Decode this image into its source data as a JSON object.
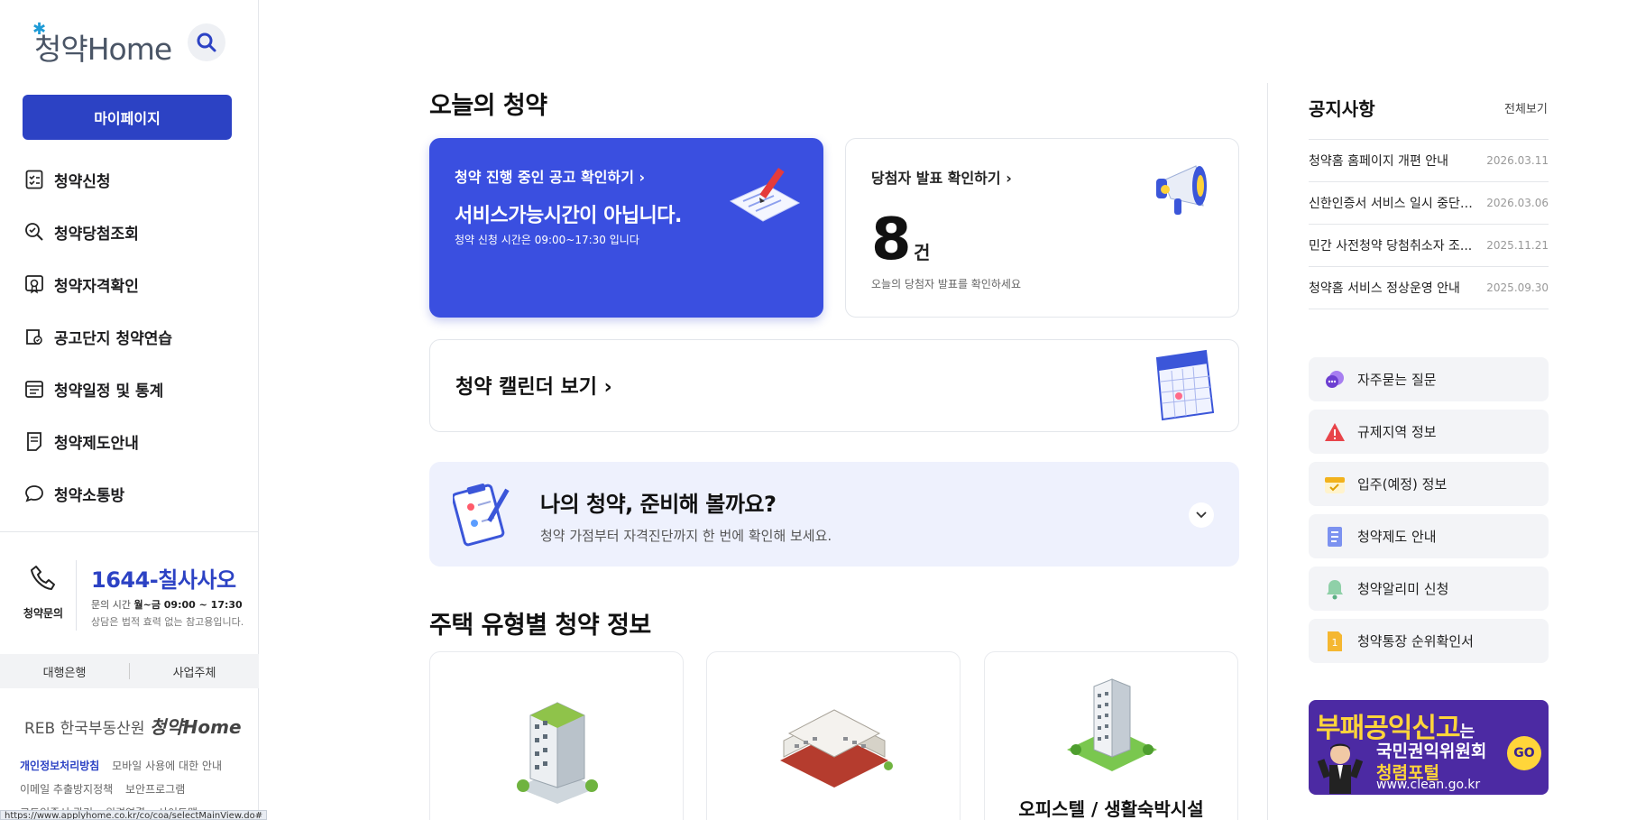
{
  "sidebar": {
    "logo_text": "청약Home",
    "mypage": "마이페이지",
    "items": [
      {
        "label": "청약신청",
        "icon": "checklist-icon"
      },
      {
        "label": "청약당첨조회",
        "icon": "search-check-icon"
      },
      {
        "label": "청약자격확인",
        "icon": "certificate-icon"
      },
      {
        "label": "공고단지 청약연습",
        "icon": "practice-icon"
      },
      {
        "label": "청약일정 및 통계",
        "icon": "calendar-stats-icon"
      },
      {
        "label": "청약제도안내",
        "icon": "document-icon"
      },
      {
        "label": "청약소통방",
        "icon": "chat-bubble-icon"
      }
    ],
    "contact": {
      "label": "청약문의",
      "phone": "1644-칠사사오",
      "hours_prefix": "문의 시간",
      "hours_value": "월~금 09:00 ~ 17:30",
      "note": "상담은 법적 효력 없는 참고용입니다."
    },
    "bank_tabs": [
      "대행은행",
      "사업주체"
    ],
    "footer_logo_prefix": "REB 한국부동산원",
    "footer_logo_brand": "청약Home",
    "footer_links": [
      "개인정보처리방침",
      "모바일 사용에 대한 안내",
      "이메일 추출방지정책",
      "보안프로그램",
      "고도인증서 관리",
      "원격연결",
      "사이트맵"
    ],
    "status_url": "https://www.applyhome.co.kr/co/coa/selectMainView.do#"
  },
  "main": {
    "title": "오늘의 청약",
    "card_apply": {
      "link": "청약 진행 중인 공고 확인하기",
      "message": "서비스가능시간이 아닙니다.",
      "sub": "청약 신청 시간은 09:00~17:30 입니다"
    },
    "card_winner": {
      "link": "당첨자 발표 확인하기",
      "count": "8",
      "unit": "건",
      "sub": "오늘의 당첨자 발표를 확인하세요"
    },
    "calendar_link": "청약 캘린더 보기",
    "prep": {
      "title": "나의 청약, 준비해 볼까요?",
      "sub": "청약 가점부터 자격진단까지 한 번에 확인해 보세요."
    },
    "house_section_title": "주택 유형별 청약 정보",
    "house_cards": [
      {
        "caption": ""
      },
      {
        "caption": ""
      },
      {
        "caption": "오피스텔 / 생활숙박시설"
      }
    ]
  },
  "notice": {
    "title": "공지사항",
    "view_all": "전체보기",
    "items": [
      {
        "title": "청약홈 홈페이지 개편 안내",
        "date": "2026.03.11"
      },
      {
        "title": "신한인증서 서비스 일시 중단 ...",
        "date": "2026.03.06"
      },
      {
        "title": "민간 사전청약 당첨취소자 조...",
        "date": "2025.11.21"
      },
      {
        "title": "청약홈 서비스 정상운영 안내",
        "date": "2025.09.30"
      }
    ]
  },
  "quick_links": [
    {
      "label": "자주묻는 질문",
      "icon": "faq-bubble-icon",
      "color": "#7b4fd8"
    },
    {
      "label": "규제지역 정보",
      "icon": "warning-icon",
      "color": "#e8444a"
    },
    {
      "label": "입주(예정) 정보",
      "icon": "calendar-check-icon",
      "color": "#f2b21c"
    },
    {
      "label": "청약제도 안내",
      "icon": "guide-doc-icon",
      "color": "#5b74e8"
    },
    {
      "label": "청약알리미 신청",
      "icon": "bell-icon",
      "color": "#7cc59a"
    },
    {
      "label": "청약통장 순위확인서",
      "icon": "rank-doc-icon",
      "color": "#f5b731"
    }
  ],
  "banner": {
    "line1": "부패공익신고",
    "line1_suffix": "는",
    "line2": "국민권익위원회",
    "line3": "청렴포털",
    "url": "www.clean.go.kr",
    "go": "GO"
  },
  "colors": {
    "primary": "#2c42c4",
    "card_blue": "#3a4fe0",
    "prep_bg": "#eef1fd"
  }
}
